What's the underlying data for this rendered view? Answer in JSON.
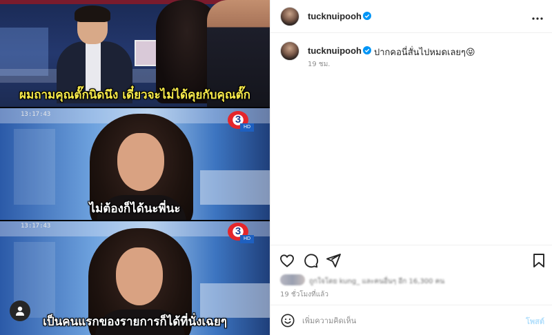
{
  "media": {
    "frames": [
      {
        "subtitle": "ผมถามคุณตั๊กนิดนึง เดี๋ยวจะไม่ได้คุยกับคุณตั๊ก"
      },
      {
        "timestamp": "13:17:43",
        "channel": "3",
        "subtitle": "ไม่ต้องก็ได้นะพี่นะ"
      },
      {
        "timestamp": "13:17:43",
        "channel": "3",
        "subtitle": "เป็นคนแรกของรายการก็ได้ที่นั่งเฉยๆ"
      }
    ],
    "tag_icon": "user-icon"
  },
  "post": {
    "header": {
      "username": "tucknuipooh",
      "verified": true,
      "more_icon": "more-icon"
    },
    "caption": {
      "username": "tucknuipooh",
      "text": "ปากคอนี่สั่นไปหมดเลยๆ😝",
      "time": "19 ชม."
    },
    "actions": {
      "like_icon": "heart-icon",
      "comment_icon": "comment-icon",
      "share_icon": "share-icon",
      "save_icon": "bookmark-icon"
    },
    "likes_text": "ถูกใจโดย kung_ และคนอื่นๆ อีก 16,300 คน",
    "time_ago": "19 ชั่วโมงที่แล้ว",
    "comment": {
      "placeholder": "เพิ่มความคิดเห็น",
      "post_label": "โพสต์",
      "emoji_icon": "emoji-icon"
    }
  },
  "colors": {
    "accent_verified": "#0095f6",
    "post_disabled": "#b2dffc",
    "subtitle_yellow": "#f6e94a"
  }
}
